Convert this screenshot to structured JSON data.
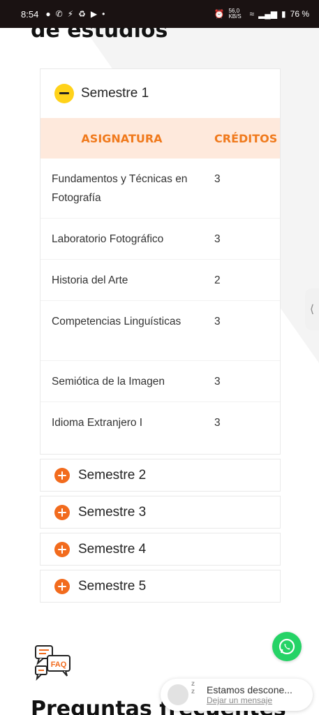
{
  "status_bar": {
    "time": "8:54",
    "battery": "76 %",
    "signal_text": "56,0 KB/S"
  },
  "page": {
    "heading": "de estudios",
    "bottom_heading": "Preguntas frecuentes"
  },
  "accordion": {
    "open_section": {
      "title": "Semestre 1",
      "columns": [
        "ASIGNATURA",
        "CRÉDITOS"
      ],
      "rows": [
        {
          "subject": "Fundamentos y Técnicas en Fotografía",
          "credits": "3"
        },
        {
          "subject": "Laboratorio Fotográfico",
          "credits": "3"
        },
        {
          "subject": "Historia del Arte",
          "credits": "2"
        },
        {
          "subject": "Competencias Linguísticas",
          "credits": "3"
        },
        {
          "subject": "Semiótica de la Imagen",
          "credits": "3"
        },
        {
          "subject": "Idioma Extranjero I",
          "credits": "3"
        }
      ]
    },
    "closed_sections": [
      {
        "title": "Semestre 2"
      },
      {
        "title": "Semestre 3"
      },
      {
        "title": "Semestre 4"
      },
      {
        "title": "Semestre 5"
      }
    ]
  },
  "faq_icon_text": "FAQ",
  "chat": {
    "status": "Estamos descone...",
    "link": "Dejar un mensaje"
  },
  "colors": {
    "accent_orange": "#f26b1d",
    "header_bg": "#fee9dc",
    "minus_yellow": "#ffd21a",
    "whatsapp_green": "#25d366"
  }
}
